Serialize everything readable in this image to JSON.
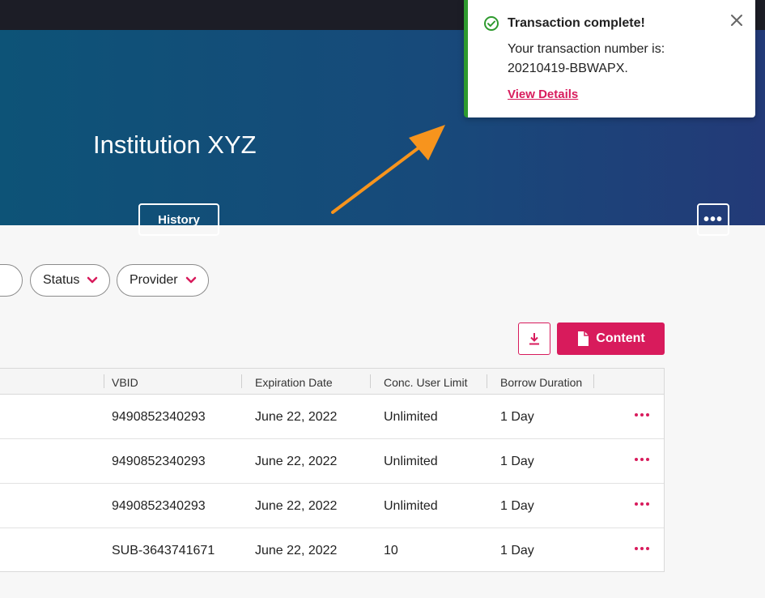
{
  "header": {
    "title": "Institution XYZ",
    "history_label": "History",
    "more_icon": "more-horizontal-icon"
  },
  "filters": [
    {
      "label": "Status"
    },
    {
      "label": "Provider"
    }
  ],
  "actions": {
    "download_icon": "download-icon",
    "content_label": "Content"
  },
  "table": {
    "columns": [
      "VBID",
      "Expiration Date",
      "Conc. User Limit",
      "Borrow Duration"
    ],
    "rows": [
      {
        "vbid": "9490852340293",
        "expiration": "June 22, 2022",
        "limit": "Unlimited",
        "duration": "1 Day"
      },
      {
        "vbid": "9490852340293",
        "expiration": "June 22, 2022",
        "limit": "Unlimited",
        "duration": "1 Day"
      },
      {
        "vbid": "9490852340293",
        "expiration": "June 22, 2022",
        "limit": "Unlimited",
        "duration": "1 Day"
      },
      {
        "vbid": "SUB-3643741671",
        "expiration": "June 22, 2022",
        "limit": "10",
        "duration": "1 Day"
      }
    ]
  },
  "toast": {
    "title": "Transaction complete!",
    "message_line1": "Your transaction number is:",
    "message_line2": "20210419-BBWAPX.",
    "link": "View Details"
  },
  "colors": {
    "accent": "#d81b5c",
    "success": "#2e9a2e",
    "arrow": "#f7941d"
  }
}
